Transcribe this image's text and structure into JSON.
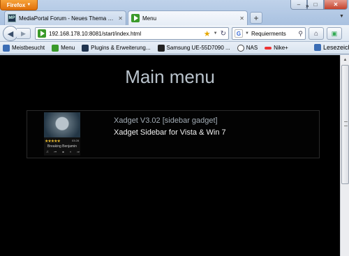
{
  "browser": {
    "menu_label": "Firefox",
    "tabs": [
      {
        "title": "MediaPortal Forum - Neues Thema e..."
      },
      {
        "title": "Menu"
      }
    ],
    "new_tab_label": "+",
    "url": "192.168.178.10:8081/start/index.html",
    "search_text": "Requierments"
  },
  "bookmarks": {
    "items": [
      "Meistbesucht",
      "Menu",
      "Plugins & Erweiterung...",
      "Samsung UE-55D7090 ...",
      "NAS",
      "Nike+"
    ],
    "more_label": "»",
    "folder_label": "Lesezeichen"
  },
  "page": {
    "title": "Main menu",
    "gadgets": [
      {
        "name": "Xadget V3.02 [sidebar gadget]",
        "description": "Xadget Sidebar for Vista & Win 7",
        "thumb_artist": "Breaking Benjamin",
        "thumb_stars": "★★★★★",
        "thumb_time": "03:28"
      }
    ]
  },
  "colors": {
    "page_background": "#000000",
    "title_color": "#b9c3cc",
    "firefox_orange": "#e0700a"
  }
}
